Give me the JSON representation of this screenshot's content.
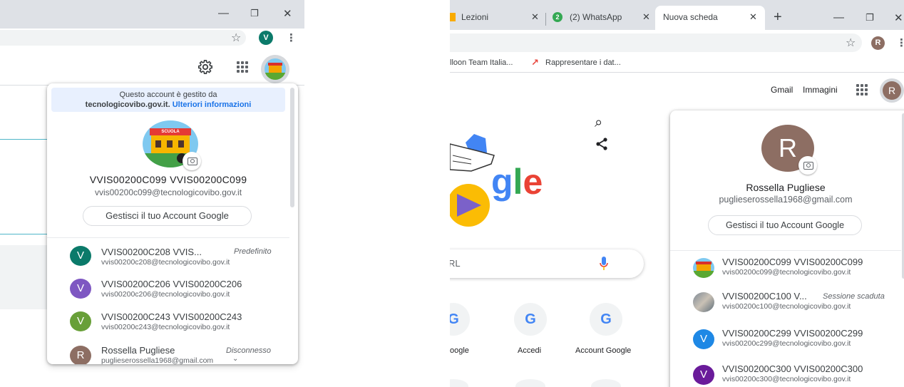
{
  "left_window": {
    "window_controls": {
      "minimize": "—",
      "restore": "❐",
      "close": "✕"
    },
    "profile_badge": "V",
    "popup": {
      "managed_notice_line1": "Questo account è gestito da",
      "managed_domain": "tecnologicovibo.gov.it.",
      "managed_link": "Ulteriori informazioni",
      "current_name": "VVIS00200C099 VVIS00200C099",
      "current_email": "vvis00200c099@tecnologicovibo.gov.it",
      "manage_button": "Gestisci il tuo Account Google",
      "school_banner": "SCUOLA",
      "accounts": [
        {
          "initial": "V",
          "color": "#0b7a6a",
          "name": "VVIS00200C208 VVIS...",
          "email": "vvis00200c208@tecnologicovibo.gov.it",
          "tag": "Predefinito"
        },
        {
          "initial": "V",
          "color": "#7e57c2",
          "name": "VVIS00200C206 VVIS00200C206",
          "email": "vvis00200c206@tecnologicovibo.gov.it",
          "tag": ""
        },
        {
          "initial": "V",
          "color": "#689f38",
          "name": "VVIS00200C243 VVIS00200C243",
          "email": "vvis00200c243@tecnologicovibo.gov.it",
          "tag": ""
        },
        {
          "initial": "R",
          "color": "#8d6e63",
          "name": "Rossella Pugliese",
          "email": "puglieserossella1968@gmail.com",
          "tag": "Disconnesso"
        }
      ]
    }
  },
  "right_window": {
    "tabs": [
      {
        "label": "Lezioni",
        "active": false,
        "icon_color": "#f9ab00"
      },
      {
        "label": "(2) WhatsApp",
        "active": false,
        "icon_color": "#34a853",
        "badge": "2"
      },
      {
        "label": "Nuova scheda",
        "active": true
      }
    ],
    "new_tab_symbol": "+",
    "window_controls": {
      "minimize": "—",
      "restore": "❐",
      "close": "✕"
    },
    "profile_badge": "R",
    "bookmarks": [
      {
        "label": "lloon Team Italia..."
      },
      {
        "label": "Rappresentare i dat..."
      }
    ],
    "header_links": {
      "gmail": "Gmail",
      "images": "Immagini"
    },
    "avatar_initial": "R",
    "doodle_text": "gle",
    "search_placeholder": "RL",
    "shortcuts": [
      {
        "letter": "G",
        "label": "oogle"
      },
      {
        "letter": "G",
        "label": "Accedi"
      },
      {
        "letter": "G",
        "label": "Account Google"
      }
    ],
    "popup": {
      "avatar_initial": "R",
      "current_name": "Rossella Pugliese",
      "current_email": "puglieserossella1968@gmail.com",
      "manage_button": "Gestisci il tuo Account Google",
      "accounts": [
        {
          "initial": "",
          "color": "#7fc9f0",
          "name": "VVIS00200C099 VVIS00200C099",
          "email": "vvis00200c099@tecnologicovibo.gov.it",
          "tag": "",
          "picture": "school"
        },
        {
          "initial": "",
          "color": "#9e9e9e",
          "name": "VVIS00200C100 V...",
          "email": "vvis00200c100@tecnologicovibo.gov.it",
          "tag": "Sessione scaduta",
          "picture": "photo"
        },
        {
          "initial": "V",
          "color": "#1e88e5",
          "name": "VVIS00200C299 VVIS00200C299",
          "email": "vvis00200c299@tecnologicovibo.gov.it",
          "tag": ""
        },
        {
          "initial": "V",
          "color": "#6a1b9a",
          "name": "VVIS00200C300 VVIS00200C300",
          "email": "vvis00200c300@tecnologicovibo.gov.it",
          "tag": ""
        }
      ]
    }
  }
}
